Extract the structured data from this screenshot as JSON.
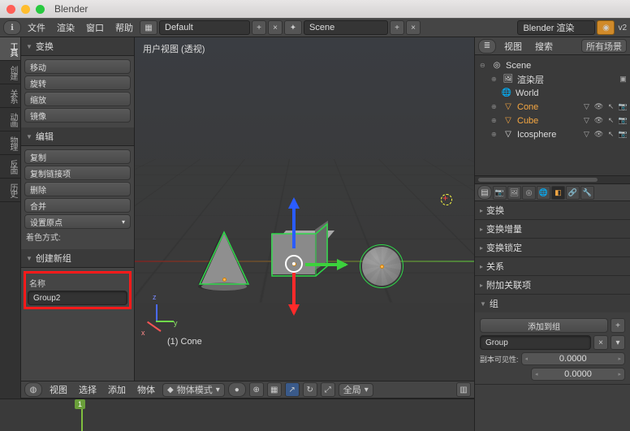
{
  "app": {
    "title": "Blender"
  },
  "topbar": {
    "menus": [
      "文件",
      "渲染",
      "窗口",
      "帮助"
    ],
    "layout": "Default",
    "scene": "Scene",
    "engine": "Blender 渲染",
    "version": "v2"
  },
  "vtabs": [
    "工具",
    "创建",
    "关系",
    "动画",
    "物理",
    "反面",
    "历史"
  ],
  "toolpanel": {
    "transform": {
      "title": "变换",
      "items": [
        "移动",
        "旋转",
        "缩放",
        "镜像"
      ]
    },
    "edit": {
      "title": "编辑",
      "items": [
        "复制",
        "复制链接项",
        "删除",
        "合并"
      ],
      "set_origin": "设置原点",
      "shade_label": "着色方式:"
    },
    "create_group": {
      "title": "创建新组",
      "name_label": "名称",
      "name_value": "Group2"
    }
  },
  "viewport": {
    "title": "用户视图 (透视)",
    "active_object": "(1) Cone",
    "axis_labels": {
      "x": "x",
      "y": "y",
      "z": "z"
    }
  },
  "vp_header": {
    "menus": [
      "视图",
      "选择",
      "添加",
      "物体"
    ],
    "mode": "物体模式",
    "orientation": "全局"
  },
  "timeline": {
    "frame": "1"
  },
  "outliner": {
    "menus": [
      "视图",
      "搜索"
    ],
    "filter": "所有场景",
    "tree": {
      "scene": "Scene",
      "render_layers": "渲染层",
      "world": "World",
      "objects": [
        {
          "name": "Cone",
          "color": "orange"
        },
        {
          "name": "Cube",
          "color": "orange"
        },
        {
          "name": "Icosphere",
          "color": "none"
        }
      ]
    }
  },
  "properties": {
    "panels": [
      "变换",
      "变换增量",
      "变换锁定",
      "关系",
      "附加关联项"
    ],
    "group_panel": {
      "title": "组",
      "add_to_group": "添加到组",
      "group_name": "Group",
      "dupli_label": "副本可见性:",
      "dupli_value": "0.0000"
    }
  }
}
